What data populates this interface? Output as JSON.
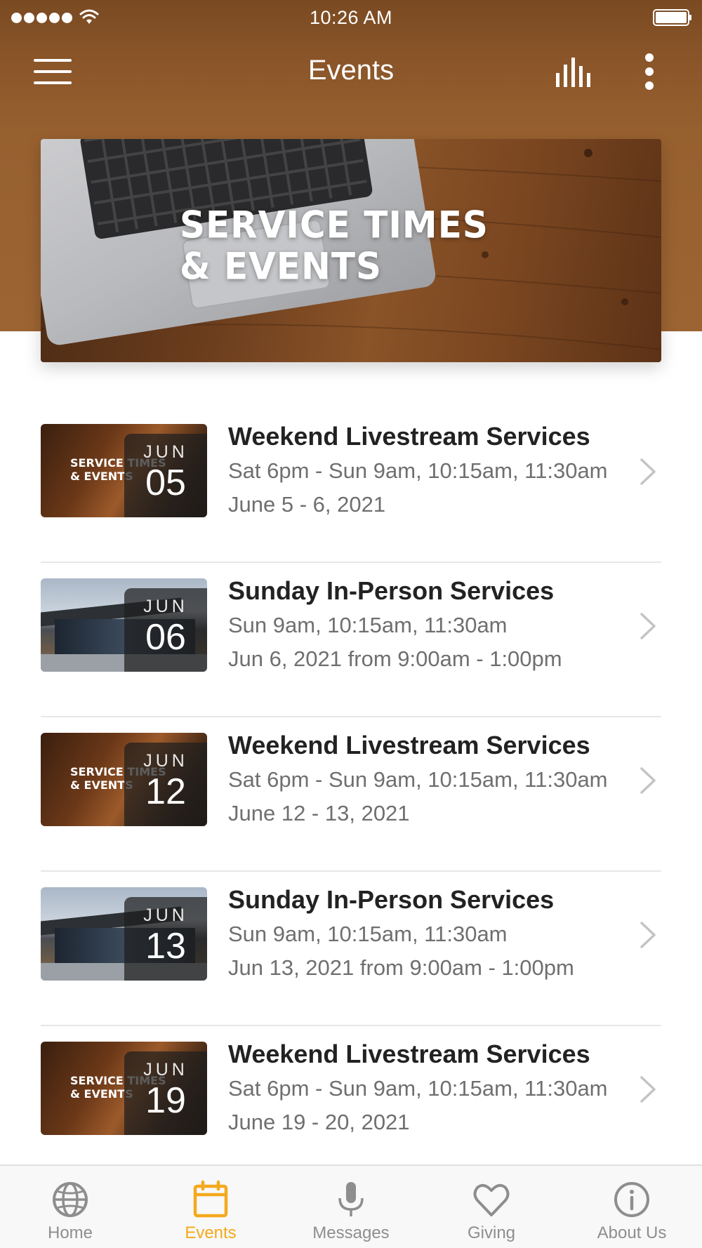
{
  "status_bar": {
    "time": "10:26 AM"
  },
  "nav": {
    "title": "Events"
  },
  "banner": {
    "line1": "SERVICE TIMES",
    "line2": "& EVENTS"
  },
  "thumb_overlay": {
    "line1": "SERVICE TIMES",
    "line2": "& EVENTS"
  },
  "events": [
    {
      "title": "Weekend Livestream Services",
      "times": "Sat 6pm - Sun 9am, 10:15am, 11:30am",
      "dates": "June 5 - 6, 2021",
      "month": "JUN",
      "day": "05",
      "thumb": "stream"
    },
    {
      "title": "Sunday In-Person Services",
      "times": "Sun 9am, 10:15am, 11:30am",
      "dates": "Jun 6, 2021 from 9:00am - 1:00pm",
      "month": "JUN",
      "day": "06",
      "thumb": "building"
    },
    {
      "title": "Weekend Livestream Services",
      "times": "Sat 6pm - Sun 9am, 10:15am, 11:30am",
      "dates": "June 12 - 13, 2021",
      "month": "JUN",
      "day": "12",
      "thumb": "stream"
    },
    {
      "title": "Sunday In-Person Services",
      "times": "Sun 9am, 10:15am, 11:30am",
      "dates": "Jun 13, 2021 from 9:00am - 1:00pm",
      "month": "JUN",
      "day": "13",
      "thumb": "building"
    },
    {
      "title": "Weekend Livestream Services",
      "times": "Sat 6pm - Sun 9am, 10:15am, 11:30am",
      "dates": "June 19 - 20, 2021",
      "month": "JUN",
      "day": "19",
      "thumb": "stream"
    }
  ],
  "tabs": [
    {
      "label": "Home",
      "icon": "globe-icon",
      "active": false
    },
    {
      "label": "Events",
      "icon": "calendar-icon",
      "active": true
    },
    {
      "label": "Messages",
      "icon": "microphone-icon",
      "active": false
    },
    {
      "label": "Giving",
      "icon": "heart-icon",
      "active": false
    },
    {
      "label": "About Us",
      "icon": "info-icon",
      "active": false
    }
  ],
  "colors": {
    "header_brown": "#9c6432",
    "active_tab": "#f4a91d",
    "inactive_tab": "#8e8e8e"
  }
}
